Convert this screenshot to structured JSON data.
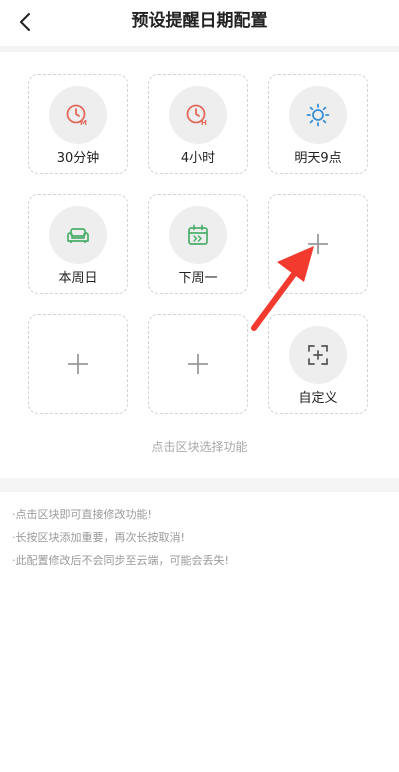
{
  "header": {
    "title": "预设提醒日期配置",
    "back_icon": "chevron-left-icon"
  },
  "tiles": [
    {
      "label": "30分钟",
      "icon": "clock-m-icon",
      "color": "#e06a5a"
    },
    {
      "label": "4小时",
      "icon": "clock-h-icon",
      "color": "#e06a5a"
    },
    {
      "label": "明天9点",
      "icon": "sun-icon",
      "color": "#3b8fd9"
    },
    {
      "label": "本周日",
      "icon": "sofa-icon",
      "color": "#4caf6a"
    },
    {
      "label": "下周一",
      "icon": "calendar-next-icon",
      "color": "#4caf6a"
    },
    {
      "label": "",
      "icon": "plus-icon"
    },
    {
      "label": "",
      "icon": "plus-icon"
    },
    {
      "label": "",
      "icon": "plus-icon"
    },
    {
      "label": "自定义",
      "icon": "custom-frame-icon",
      "color": "#555555"
    }
  ],
  "hint": "点击区块选择功能",
  "notes": [
    "·点击区块即可直接修改功能!",
    "·长按区块添加重要，再次长按取消!",
    "·此配置修改后不会同步至云端，可能会丢失!"
  ],
  "colors": {
    "accent_red": "#e06a5a",
    "accent_blue": "#3b8fd9",
    "accent_green": "#4caf6a",
    "arrow_red": "#f23a2f"
  }
}
